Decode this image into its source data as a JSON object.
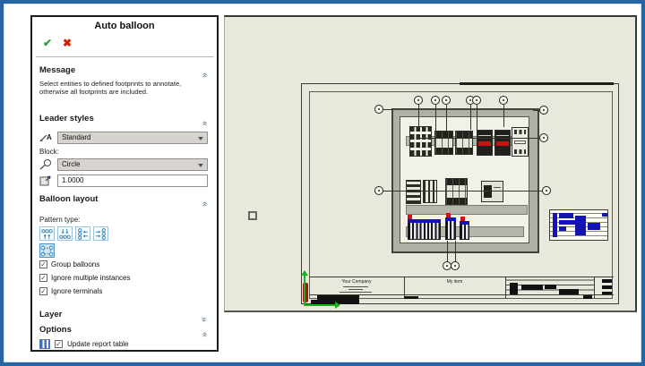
{
  "dialog": {
    "title": "Auto balloon",
    "message": {
      "header": "Message",
      "body": "Select entities to defined footprints to annotate, otherwise all footprints are included."
    },
    "leader_styles": {
      "header": "Leader styles",
      "style_value": "Standard",
      "block_label": "Block:",
      "block_value": "Circle",
      "scale_value": "1.0000"
    },
    "balloon_layout": {
      "header": "Balloon layout",
      "pattern_label": "Pattern type:",
      "checkboxes": [
        {
          "label": "Group balloons",
          "checked": true
        },
        {
          "label": "Ignore multiple instances",
          "checked": true
        },
        {
          "label": "Ignore terminals",
          "checked": true
        }
      ]
    },
    "layer": {
      "header": "Layer"
    },
    "options": {
      "header": "Options",
      "update_report_label": "Update report table"
    }
  },
  "canvas": {
    "title_block": {
      "company": "Your Company",
      "drawing_name": "My item"
    }
  },
  "icons": {
    "confirm": "✔",
    "cancel": "✖",
    "double_chevron": "«",
    "checkmark": "✓"
  },
  "colors": {
    "window_border": "#2565a4",
    "canvas_bg": "#e9e8dd",
    "cabinet_gray": "#b1b0a7",
    "terminal_blue": "#1414b4",
    "component_red": "#cc1111",
    "confirm_green": "#2f9e2f",
    "cancel_red": "#d02000",
    "ucs_green": "#17b517"
  }
}
